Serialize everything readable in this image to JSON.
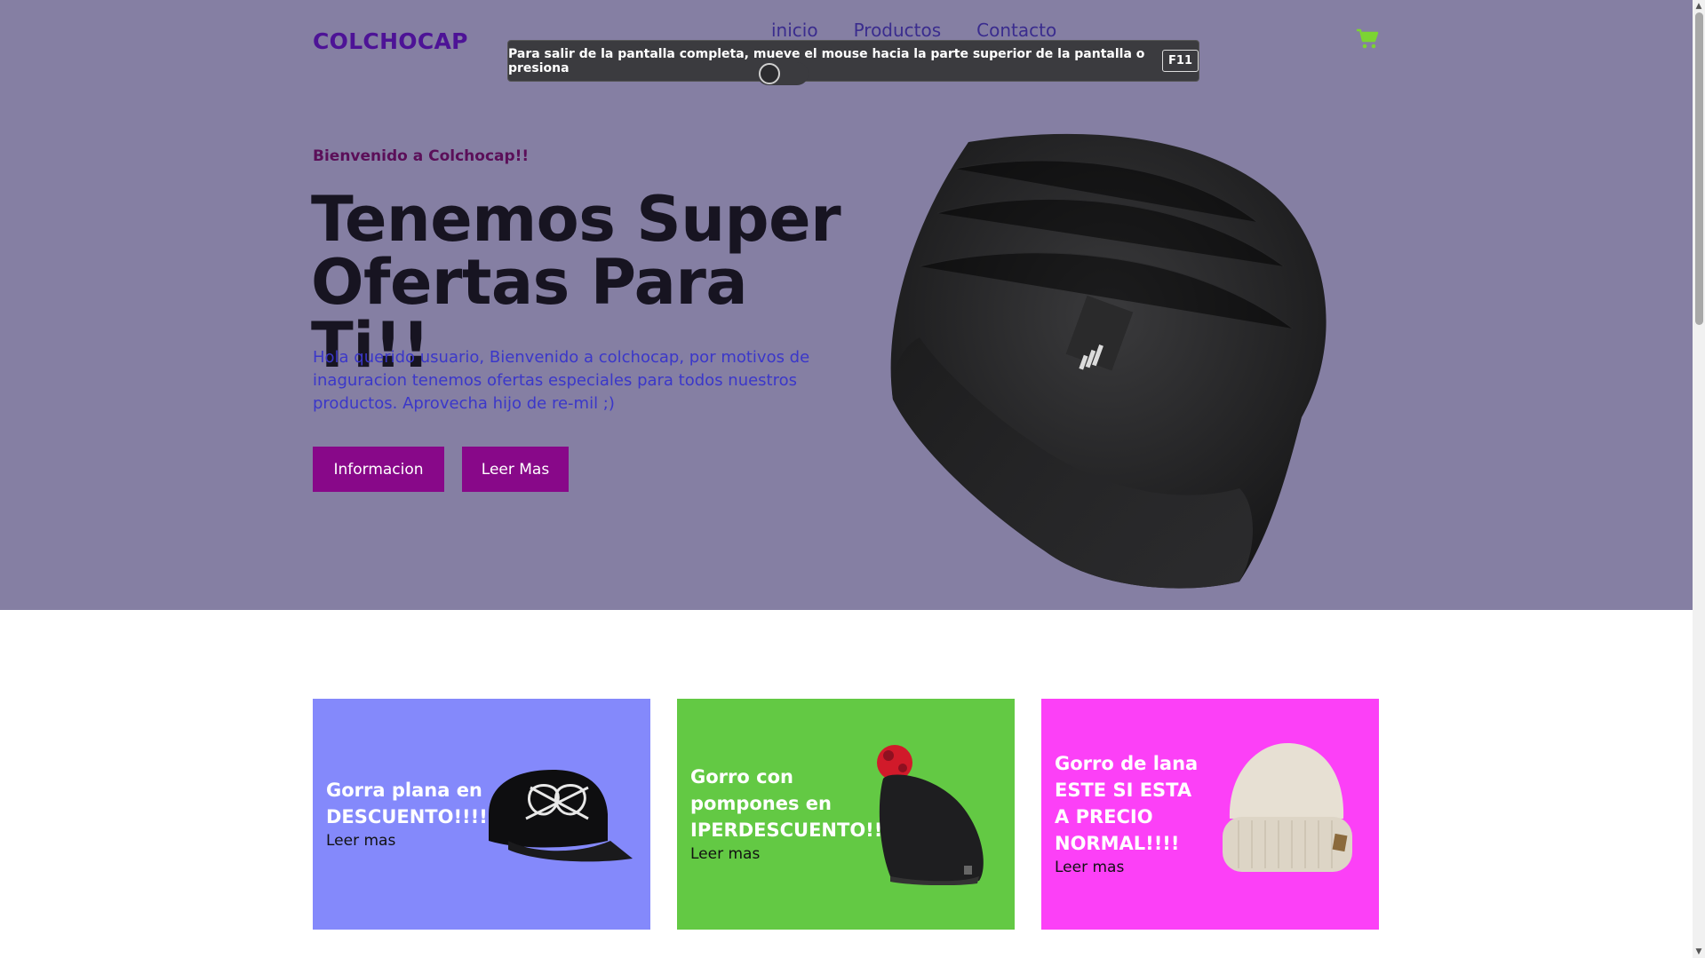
{
  "brand": {
    "logo": "COLCHOCAP",
    "accent": "#880889",
    "hero_bg": "#857fa3"
  },
  "nav": {
    "items": [
      "inicio",
      "Productos",
      "Contacto"
    ]
  },
  "header": {
    "cart_icon": "cart-icon",
    "cart_color": "#7cd432"
  },
  "fullscreen_notice": {
    "message": "Para salir de la pantalla completa, mueve el mouse hacia la parte superior de la pantalla o presiona",
    "key": "F11"
  },
  "hero": {
    "kicker": "Bienvenido a Colchocap!!",
    "headline": "Tenemos Super Ofertas Para Ti!!",
    "intro": "Hola querido usuario, Bienvenido a colchocap, por motivos de inaguracion tenemos ofertas especiales para todos nuestros productos. Aprovecha hijo de re-mil ;)",
    "buttons": [
      "Informacion",
      "Leer Mas"
    ]
  },
  "cards": [
    {
      "title": "Gorra plana en DESCUENTO!!!!",
      "link": "Leer mas",
      "bg": "#8489fb"
    },
    {
      "title": "Gorro con pompones en IPERDESCUENTO!!!!",
      "link": "Leer mas",
      "bg": "#63c944"
    },
    {
      "title": "Gorro de lana ESTE SI ESTA A PRECIO NORMAL!!!!",
      "link": "Leer mas",
      "bg": "#fc40f7"
    }
  ]
}
